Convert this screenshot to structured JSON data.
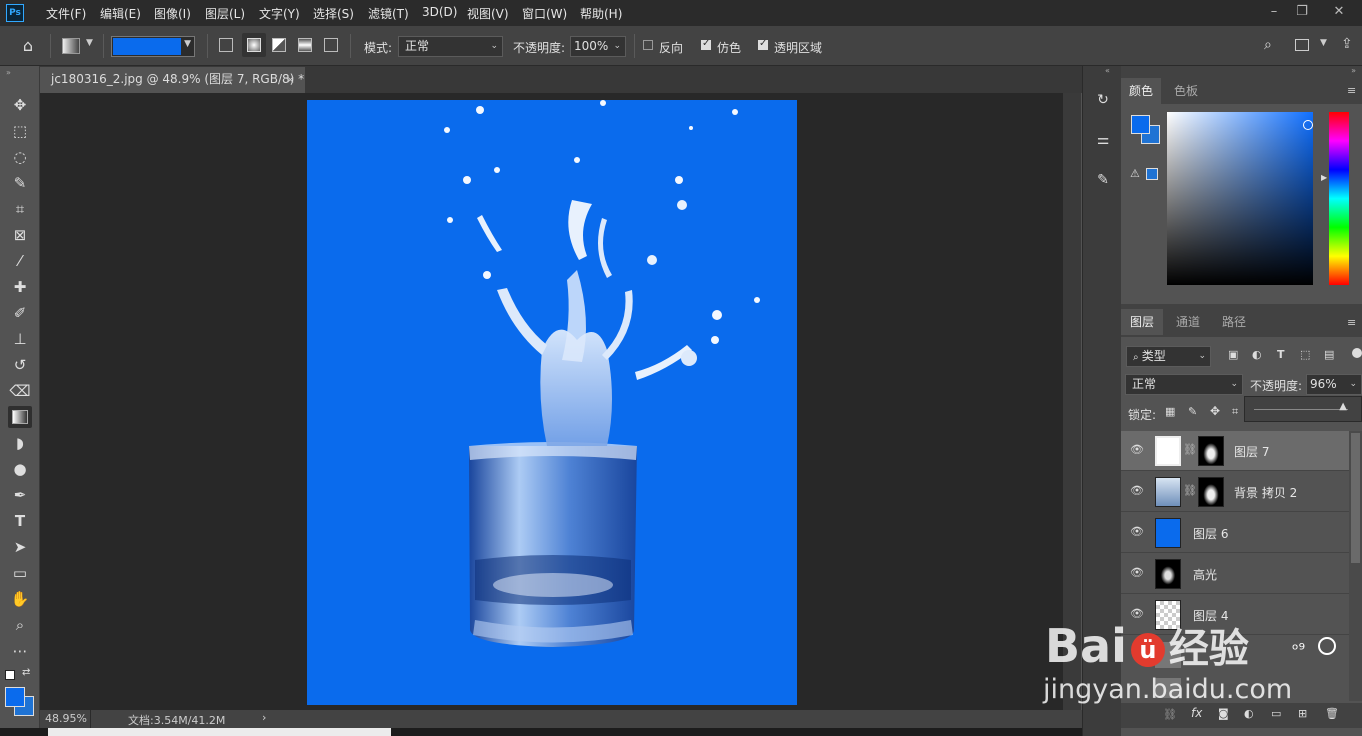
{
  "app": {
    "logo": "Ps"
  },
  "menu": [
    "文件(F)",
    "编辑(E)",
    "图像(I)",
    "图层(L)",
    "文字(Y)",
    "选择(S)",
    "滤镜(T)",
    "3D(D)",
    "视图(V)",
    "窗口(W)",
    "帮助(H)"
  ],
  "options": {
    "mode_label": "模式:",
    "mode_value": "正常",
    "opacity_label": "不透明度:",
    "opacity_value": "100%",
    "reverse_label": "反向",
    "dither_label": "仿色",
    "transparency_label": "透明区域",
    "reverse_checked": false,
    "dither_checked": true,
    "transparency_checked": true,
    "gradient_color": "#0a6bed"
  },
  "document": {
    "tab_title": "jc180316_2.jpg @ 48.9% (图层 7, RGB/8) *",
    "canvas_color": "#0a6bed"
  },
  "status": {
    "zoom": "48.95%",
    "doc_info": "文档:3.54M/41.2M"
  },
  "color_panel": {
    "tabs": [
      "颜色",
      "色板"
    ],
    "foreground": "#0a6bed",
    "background": "#1f73d4"
  },
  "layers_panel": {
    "tabs": [
      "图层",
      "通道",
      "路径"
    ],
    "filter_kind": "类型",
    "blend_mode": "正常",
    "opacity_label": "不透明度:",
    "opacity_value": "96%",
    "lock_label": "锁定:",
    "layers": [
      {
        "name": "图层 7",
        "selected": true
      },
      {
        "name": "背景 拷贝 2",
        "selected": false
      },
      {
        "name": "图层 6",
        "selected": false
      },
      {
        "name": "高光",
        "selected": false
      },
      {
        "name": "图层 4",
        "selected": false
      }
    ]
  },
  "watermark": {
    "brand": "Bai",
    "brand_tail": "经验",
    "url": "jingyan.baidu.com"
  }
}
